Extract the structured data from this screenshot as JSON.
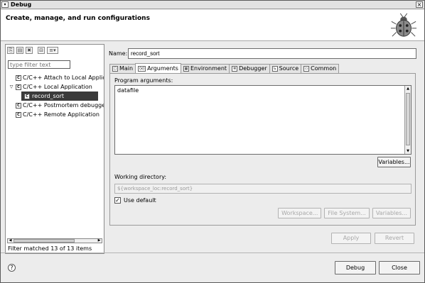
{
  "window": {
    "title": "Debug",
    "menu_glyph": "▾",
    "close_glyph": "×"
  },
  "banner": {
    "heading": "Create, manage, and run configurations",
    "icon": "bug-icon"
  },
  "left_panel": {
    "toolbar": [
      {
        "name": "new-launch-config-icon",
        "glyph": "⎘"
      },
      {
        "name": "duplicate-config-icon",
        "glyph": "▤"
      },
      {
        "name": "delete-config-icon",
        "glyph": "✖"
      },
      {
        "name": "collapse-all-icon",
        "glyph": "⊟"
      },
      {
        "name": "filter-menu-icon",
        "glyph": "≡▾"
      }
    ],
    "filter": {
      "placeholder": "type filter text"
    },
    "tree": [
      {
        "label": "C/C++ Attach to Local Applic",
        "indent": 0,
        "twisty": ""
      },
      {
        "label": "C/C++ Local Application",
        "indent": 0,
        "twisty": "▽"
      },
      {
        "label": "record_sort",
        "indent": 1,
        "twisty": "",
        "selected": true
      },
      {
        "label": "C/C++ Postmortem debugger",
        "indent": 0,
        "twisty": ""
      },
      {
        "label": "C/C++ Remote Application",
        "indent": 0,
        "twisty": ""
      }
    ],
    "status": "Filter matched 13 of 13 items"
  },
  "name_field": {
    "label": "Name:",
    "value": "record_sort"
  },
  "tabs": [
    {
      "label": "Main",
      "icon": "main-tab-icon",
      "glyph": "▢"
    },
    {
      "label": "Arguments",
      "icon": "arguments-tab-icon",
      "glyph": "(x)",
      "active": true
    },
    {
      "label": "Environment",
      "icon": "environment-tab-icon",
      "glyph": "▦"
    },
    {
      "label": "Debugger",
      "icon": "debugger-tab-icon",
      "glyph": "✲"
    },
    {
      "label": "Source",
      "icon": "source-tab-icon",
      "glyph": "↳"
    },
    {
      "label": "Common",
      "icon": "common-tab-icon",
      "glyph": "▭"
    }
  ],
  "arguments": {
    "program_label": "Program arguments:",
    "program_value": "datafile",
    "variables_button": "Variables...",
    "working_dir_label": "Working directory:",
    "working_dir_value": "${workspace_loc:record_sort}",
    "use_default_label": "Use default",
    "use_default_checked": true,
    "workspace_button": "Workspace...",
    "filesystem_button": "File System...",
    "variables2_button": "Variables..."
  },
  "actions": {
    "apply": "Apply",
    "revert": "Revert",
    "debug": "Debug",
    "close": "Close",
    "help_glyph": "?"
  }
}
